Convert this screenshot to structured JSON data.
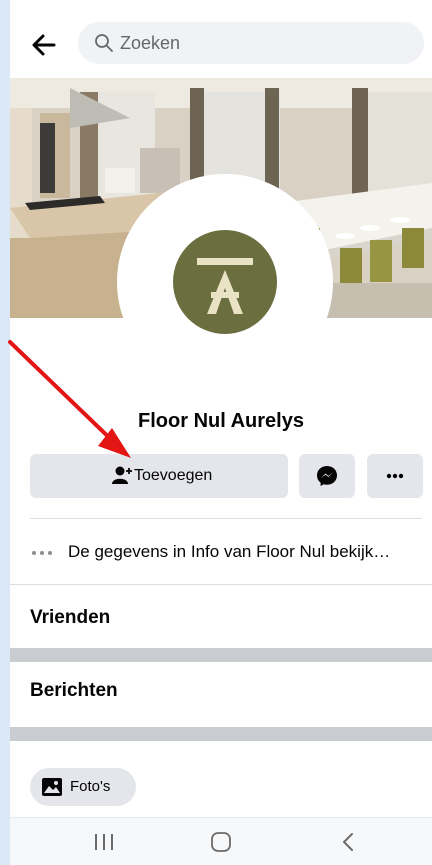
{
  "search": {
    "placeholder": "Zoeken"
  },
  "profile": {
    "name": "Floor Nul Aurelys"
  },
  "actions": {
    "add_friend_label": "Toevoegen"
  },
  "info": {
    "text": "De gegevens in Info van Floor Nul bekijk…"
  },
  "sections": {
    "friends_title": "Vrienden",
    "posts_title": "Berichten"
  },
  "photos": {
    "label": "Foto's"
  },
  "colors": {
    "annotation": "#e31515",
    "logo_bg": "#6b6e3f",
    "logo_fg": "#e9e2c4"
  },
  "icons": [
    "back-arrow-icon",
    "search-icon",
    "add-person-icon",
    "messenger-icon",
    "more-icon",
    "dots-icon",
    "photo-icon",
    "recent-apps-icon",
    "home-icon",
    "nav-back-icon"
  ]
}
